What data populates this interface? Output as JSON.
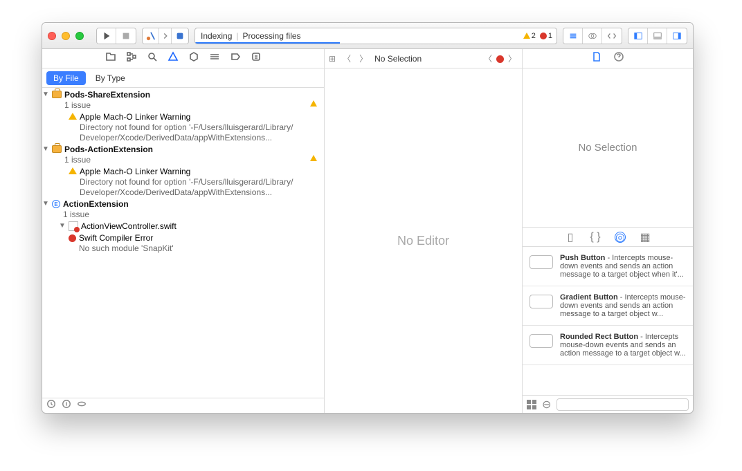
{
  "toolbar": {
    "status_left": "Indexing",
    "status_right": "Processing files",
    "warn_count": "2",
    "err_count": "1"
  },
  "filter": {
    "by_file": "By File",
    "by_type": "By Type"
  },
  "issues": {
    "group1": {
      "name": "Pods-ShareExtension",
      "count": "1 issue",
      "warn_title": "Apple Mach-O Linker Warning",
      "warn_msg1": "Directory not found for option '-F/Users/lluisgerard/Library/",
      "warn_msg2": "Developer/Xcode/DerivedData/appWithExtensions..."
    },
    "group2": {
      "name": "Pods-ActionExtension",
      "count": "1 issue",
      "warn_title": "Apple Mach-O Linker Warning",
      "warn_msg1": "Directory not found for option '-F/Users/lluisgerard/Library/",
      "warn_msg2": "Developer/Xcode/DerivedData/appWithExtensions..."
    },
    "group3": {
      "name": "ActionExtension",
      "count": "1 issue",
      "file": "ActionViewController.swift",
      "err_title": "Swift Compiler Error",
      "err_msg": "No such module 'SnapKit'"
    }
  },
  "jumpbar": {
    "label": "No Selection"
  },
  "editor": {
    "placeholder": "No Editor"
  },
  "inspector": {
    "placeholder": "No Selection",
    "items": [
      {
        "name": "Push Button",
        "desc": " - Intercepts mouse-down events and sends an action message to a target object when it'..."
      },
      {
        "name": "Gradient Button",
        "desc": " - Intercepts mouse-down events and sends an action message to a target object w..."
      },
      {
        "name": "Rounded Rect Button",
        "desc": " - Intercepts mouse-down events and sends an action message to a target object w..."
      }
    ]
  }
}
